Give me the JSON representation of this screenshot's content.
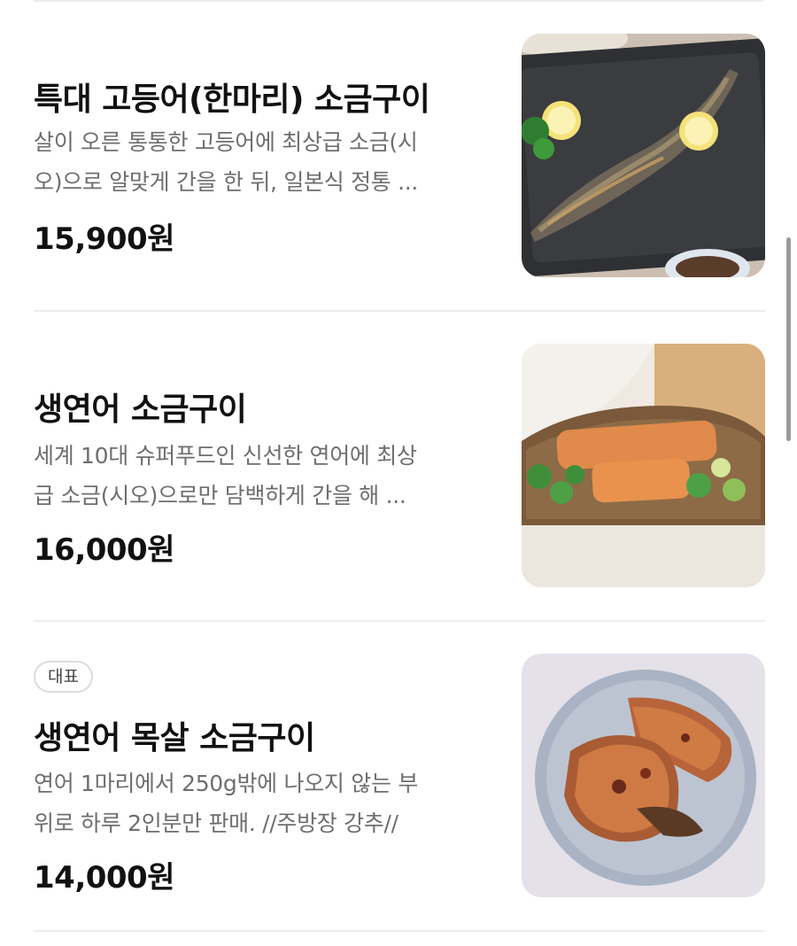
{
  "menu": {
    "items": [
      {
        "badge": "",
        "title": "특대 고등어(한마리) 소금구이",
        "desc_line1": "살이 오른 통통한 고등어에 최상급 소금(시",
        "desc_line2": "오)으로 알맞게 간을 한 뒤, 일본식 정통 ...",
        "price": "15,900원",
        "image_icon": "grilled-mackerel-image"
      },
      {
        "badge": "",
        "title": "생연어 소금구이",
        "desc_line1": "세계 10대 슈퍼푸드인 신선한 연어에 최상",
        "desc_line2": "급 소금(시오)으로만 담백하게 간을 해 ...",
        "price": "16,000원",
        "image_icon": "grilled-salmon-image"
      },
      {
        "badge": "대표",
        "title": "생연어 목살 소금구이",
        "desc_line1": "연어 1마리에서 250g밖에 나오지 않는 부",
        "desc_line2": "위로 하루 2인분만 판매. //주방장 강추//",
        "price": "14,000원",
        "image_icon": "salmon-collar-image"
      }
    ]
  },
  "colors": {
    "title": "#111111",
    "description": "#6e6e6e",
    "divider": "#ececec",
    "badge_border": "#dcdcdc"
  }
}
